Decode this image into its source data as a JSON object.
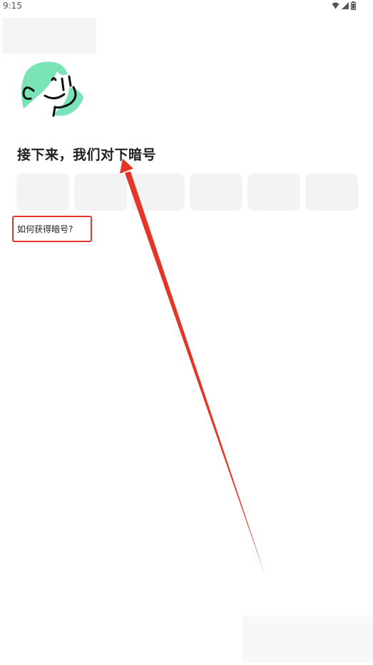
{
  "status_bar": {
    "time": "9:15",
    "icons": [
      "wifi-icon",
      "signal-icon",
      "battery-icon"
    ]
  },
  "page": {
    "title": "接下来，我们对下暗号",
    "code_boxes": [
      "",
      "",
      "",
      "",
      "",
      ""
    ],
    "help_link": "如何获得暗号?"
  },
  "colors": {
    "logo_accent": "#7be3b8",
    "annotation": "#e53528",
    "input_bg": "#f3f3f3"
  }
}
